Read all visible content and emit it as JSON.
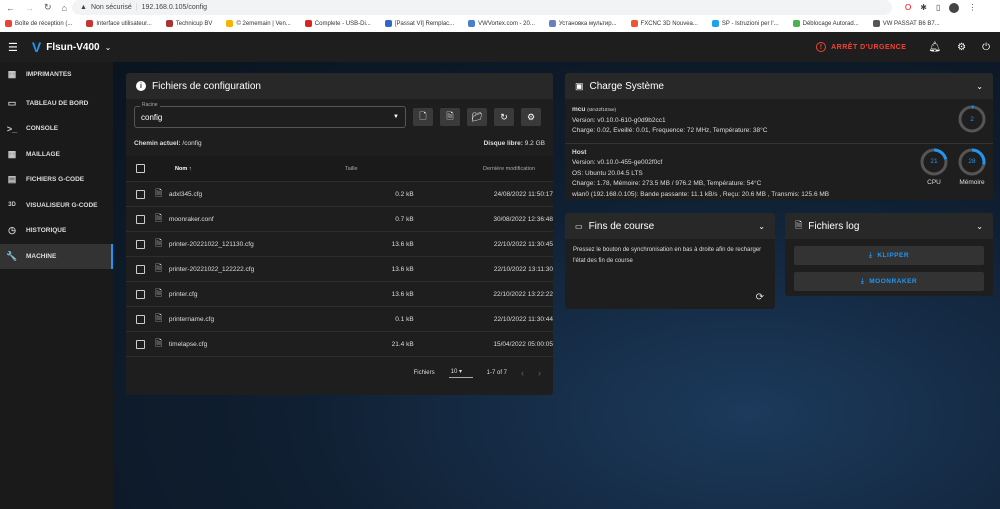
{
  "browser": {
    "security": "Non sécurisé",
    "url": "192.168.0.105/config",
    "bookmarks": [
      "Boîte de réception (...",
      "Interface utilisateur...",
      "Technicup BV",
      "© 2ememain | Ven...",
      "Complete - USB-Di...",
      "[Passat VI] Remplac...",
      "VWVortex.com - 20...",
      "Установка мультир...",
      "FXCNC 3D Nouvea...",
      "SP - Istruzioni per l'...",
      "Déblocage Autorad...",
      "VW PASSAT B6 B7..."
    ]
  },
  "app": {
    "title": "Flsun-V400",
    "emergency": "ARRÊT D'URGENCE"
  },
  "sidebar": {
    "items": [
      {
        "label": "IMPRIMANTES",
        "icon": "▦"
      },
      {
        "label": "TABLEAU DE BORD",
        "icon": "▭"
      },
      {
        "label": "CONSOLE",
        "icon": ">_"
      },
      {
        "label": "MAILLAGE",
        "icon": "▦"
      },
      {
        "label": "FICHIERS G-CODE",
        "icon": "▤"
      },
      {
        "label": "VISUALISEUR G-CODE",
        "icon": "3D"
      },
      {
        "label": "HISTORIQUE",
        "icon": "◷"
      },
      {
        "label": "MACHINE",
        "icon": "🔧"
      }
    ]
  },
  "files": {
    "title": "Fichiers de configuration",
    "root_label": "Racine",
    "root_value": "config",
    "path_label": "Chemin actuel:",
    "path": "/config",
    "disk_label": "Disque libre:",
    "disk": "9.2 GB",
    "headers": {
      "name": "Nom",
      "size": "Taille",
      "modified": "Dernière modification"
    },
    "rows": [
      {
        "name": "adxl345.cfg",
        "size": "0.2 kB",
        "modified": "24/08/2022 11:50:17"
      },
      {
        "name": "moonraker.conf",
        "size": "0.7 kB",
        "modified": "30/08/2022 12:36:48"
      },
      {
        "name": "printer-20221022_121130.cfg",
        "size": "13.6 kB",
        "modified": "22/10/2022 11:30:45"
      },
      {
        "name": "printer-20221022_122222.cfg",
        "size": "13.6 kB",
        "modified": "22/10/2022 13:11:30"
      },
      {
        "name": "printer.cfg",
        "size": "13.6 kB",
        "modified": "22/10/2022 13:22:22"
      },
      {
        "name": "printername.cfg",
        "size": "0.1 kB",
        "modified": "22/10/2022 11:30:44"
      },
      {
        "name": "timelapse.cfg",
        "size": "21.4 kB",
        "modified": "15/04/2022 05:00:05"
      }
    ],
    "footer": {
      "label": "Fichiers",
      "per_page": "10",
      "range": "1-7 of 7"
    }
  },
  "system": {
    "title": "Charge Système",
    "mcu": {
      "name": "mcu",
      "chip": "(stm32f103xe)",
      "version": "Version: v0.10.0-610-g0d9b2cc1",
      "stats": "Charge: 0.02, Eveillé: 0.01, Frequence: 72 MHz, Température: 38°C",
      "gauge": 2
    },
    "host": {
      "name": "Host",
      "version": "Version: v0.10.0-455-ge002f0cf",
      "os": "OS: Ubuntu 20.04.5 LTS",
      "stats": "Charge: 1.78, Mémoire: 273.5 MB / 976.2 MB, Température: 54°C",
      "net": "wlan0 (192.168.0.105): Bande passante: 11.1 kB/s , Reçu: 20.6 MB , Transmis: 125.6 MB",
      "cpu": 21,
      "cpu_label": "CPU",
      "mem": 28,
      "mem_label": "Mémoire"
    }
  },
  "endstops": {
    "title": "Fins de course",
    "text": "Pressez le bouton de synchronisation en bas à droite afin de recharger l'état des fin de course"
  },
  "logs": {
    "title": "Fichiers log",
    "buttons": [
      "KLIPPER",
      "MOONRAKER"
    ]
  },
  "colors": {
    "accent": "#2196f3",
    "emergency": "#f44336"
  }
}
